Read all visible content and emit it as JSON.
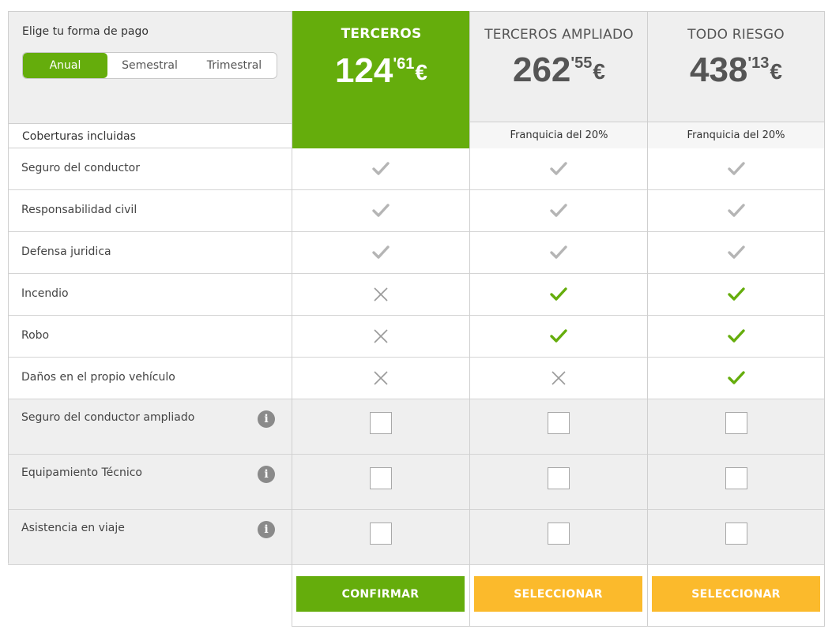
{
  "payment": {
    "title": "Elige tu forma de pago",
    "options": [
      "Anual",
      "Semestral",
      "Trimestral"
    ],
    "selected": "Anual"
  },
  "coverage_title": "Coberturas incluidas",
  "plans": [
    {
      "name": "TERCEROS",
      "price_int": "124",
      "price_dec": "'61",
      "currency": "€",
      "franquicia": "",
      "button": "CONFIRMAR",
      "button_color": "#65ad0c"
    },
    {
      "name": "TERCEROS AMPLIADO",
      "price_int": "262",
      "price_dec": "'55",
      "currency": "€",
      "franquicia": "Franquicia del 20%",
      "button": "SELECCIONAR",
      "button_color": "#fbba2c"
    },
    {
      "name": "TODO RIESGO",
      "price_int": "438",
      "price_dec": "'13",
      "currency": "€",
      "franquicia": "Franquicia del 20%",
      "button": "SELECCIONAR",
      "button_color": "#fbba2c"
    }
  ],
  "coverages": [
    {
      "label": "Seguro del conductor",
      "values": [
        "included",
        "included",
        "included"
      ]
    },
    {
      "label": "Responsabilidad civil",
      "values": [
        "included",
        "included",
        "included"
      ]
    },
    {
      "label": "Defensa juridica",
      "values": [
        "included",
        "included",
        "included"
      ]
    },
    {
      "label": "Incendio",
      "values": [
        "no",
        "yes",
        "yes"
      ]
    },
    {
      "label": "Robo",
      "values": [
        "no",
        "yes",
        "yes"
      ]
    },
    {
      "label": "Daños en el propio vehículo",
      "values": [
        "no",
        "no",
        "yes"
      ]
    }
  ],
  "extras": [
    {
      "label": "Seguro del conductor ampliado",
      "info_icon": "info-icon",
      "checked": [
        false,
        false,
        false
      ]
    },
    {
      "label": "Equipamiento Técnico",
      "info_icon": "info-icon",
      "checked": [
        false,
        false,
        false
      ]
    },
    {
      "label": "Asistencia en viaje",
      "info_icon": "info-icon",
      "checked": [
        false,
        false,
        false
      ]
    }
  ],
  "colors": {
    "accent_green": "#65ad0c",
    "button_yellow": "#fbba2c",
    "check_grey": "#b5b5b5",
    "cross_grey": "#9a9a9a"
  }
}
